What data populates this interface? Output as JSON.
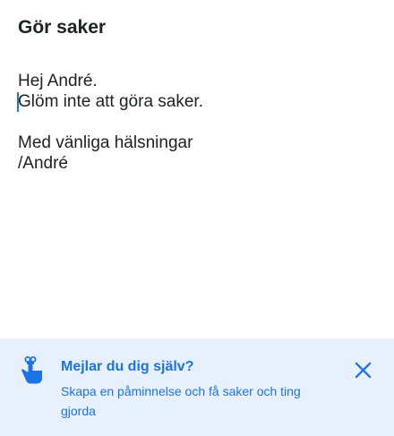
{
  "compose": {
    "subject": "Gör saker",
    "body_lines": [
      "Hej André.",
      "Glöm inte att göra saker.",
      "",
      "Med vänliga hälsningar",
      "/André"
    ]
  },
  "banner": {
    "title": "Mejlar du dig själv?",
    "description": "Skapa en påminnelse och få saker och ting gjorda",
    "icon": "finger-string-reminder-icon",
    "close_icon": "close-icon"
  },
  "colors": {
    "accent": "#1a73e8",
    "banner_background": "#e8f0fe",
    "text": "#202124"
  }
}
